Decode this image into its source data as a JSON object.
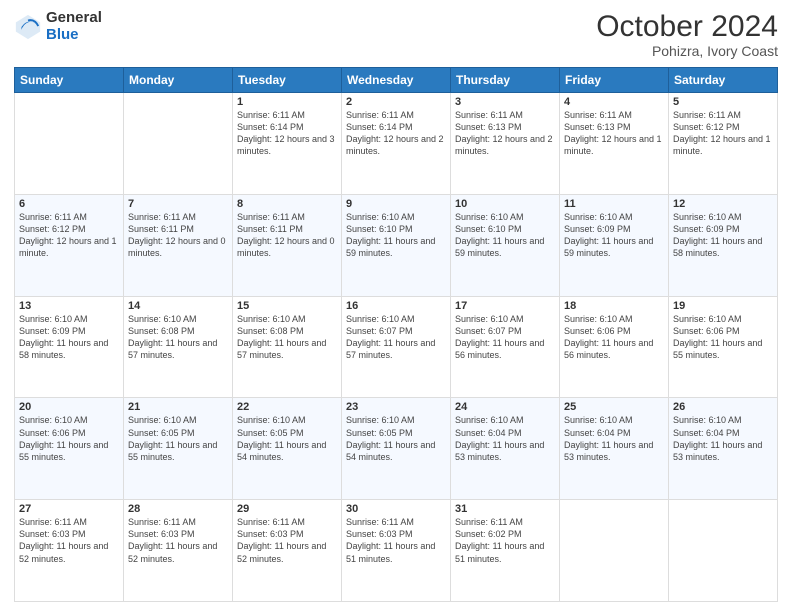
{
  "header": {
    "logo_general": "General",
    "logo_blue": "Blue",
    "title": "October 2024",
    "subtitle": "Pohizra, Ivory Coast"
  },
  "weekdays": [
    "Sunday",
    "Monday",
    "Tuesday",
    "Wednesday",
    "Thursday",
    "Friday",
    "Saturday"
  ],
  "weeks": [
    [
      {
        "day": "",
        "sunrise": "",
        "sunset": "",
        "daylight": ""
      },
      {
        "day": "",
        "sunrise": "",
        "sunset": "",
        "daylight": ""
      },
      {
        "day": "1",
        "sunrise": "Sunrise: 6:11 AM",
        "sunset": "Sunset: 6:14 PM",
        "daylight": "Daylight: 12 hours and 3 minutes."
      },
      {
        "day": "2",
        "sunrise": "Sunrise: 6:11 AM",
        "sunset": "Sunset: 6:14 PM",
        "daylight": "Daylight: 12 hours and 2 minutes."
      },
      {
        "day": "3",
        "sunrise": "Sunrise: 6:11 AM",
        "sunset": "Sunset: 6:13 PM",
        "daylight": "Daylight: 12 hours and 2 minutes."
      },
      {
        "day": "4",
        "sunrise": "Sunrise: 6:11 AM",
        "sunset": "Sunset: 6:13 PM",
        "daylight": "Daylight: 12 hours and 1 minute."
      },
      {
        "day": "5",
        "sunrise": "Sunrise: 6:11 AM",
        "sunset": "Sunset: 6:12 PM",
        "daylight": "Daylight: 12 hours and 1 minute."
      }
    ],
    [
      {
        "day": "6",
        "sunrise": "Sunrise: 6:11 AM",
        "sunset": "Sunset: 6:12 PM",
        "daylight": "Daylight: 12 hours and 1 minute."
      },
      {
        "day": "7",
        "sunrise": "Sunrise: 6:11 AM",
        "sunset": "Sunset: 6:11 PM",
        "daylight": "Daylight: 12 hours and 0 minutes."
      },
      {
        "day": "8",
        "sunrise": "Sunrise: 6:11 AM",
        "sunset": "Sunset: 6:11 PM",
        "daylight": "Daylight: 12 hours and 0 minutes."
      },
      {
        "day": "9",
        "sunrise": "Sunrise: 6:10 AM",
        "sunset": "Sunset: 6:10 PM",
        "daylight": "Daylight: 11 hours and 59 minutes."
      },
      {
        "day": "10",
        "sunrise": "Sunrise: 6:10 AM",
        "sunset": "Sunset: 6:10 PM",
        "daylight": "Daylight: 11 hours and 59 minutes."
      },
      {
        "day": "11",
        "sunrise": "Sunrise: 6:10 AM",
        "sunset": "Sunset: 6:09 PM",
        "daylight": "Daylight: 11 hours and 59 minutes."
      },
      {
        "day": "12",
        "sunrise": "Sunrise: 6:10 AM",
        "sunset": "Sunset: 6:09 PM",
        "daylight": "Daylight: 11 hours and 58 minutes."
      }
    ],
    [
      {
        "day": "13",
        "sunrise": "Sunrise: 6:10 AM",
        "sunset": "Sunset: 6:09 PM",
        "daylight": "Daylight: 11 hours and 58 minutes."
      },
      {
        "day": "14",
        "sunrise": "Sunrise: 6:10 AM",
        "sunset": "Sunset: 6:08 PM",
        "daylight": "Daylight: 11 hours and 57 minutes."
      },
      {
        "day": "15",
        "sunrise": "Sunrise: 6:10 AM",
        "sunset": "Sunset: 6:08 PM",
        "daylight": "Daylight: 11 hours and 57 minutes."
      },
      {
        "day": "16",
        "sunrise": "Sunrise: 6:10 AM",
        "sunset": "Sunset: 6:07 PM",
        "daylight": "Daylight: 11 hours and 57 minutes."
      },
      {
        "day": "17",
        "sunrise": "Sunrise: 6:10 AM",
        "sunset": "Sunset: 6:07 PM",
        "daylight": "Daylight: 11 hours and 56 minutes."
      },
      {
        "day": "18",
        "sunrise": "Sunrise: 6:10 AM",
        "sunset": "Sunset: 6:06 PM",
        "daylight": "Daylight: 11 hours and 56 minutes."
      },
      {
        "day": "19",
        "sunrise": "Sunrise: 6:10 AM",
        "sunset": "Sunset: 6:06 PM",
        "daylight": "Daylight: 11 hours and 55 minutes."
      }
    ],
    [
      {
        "day": "20",
        "sunrise": "Sunrise: 6:10 AM",
        "sunset": "Sunset: 6:06 PM",
        "daylight": "Daylight: 11 hours and 55 minutes."
      },
      {
        "day": "21",
        "sunrise": "Sunrise: 6:10 AM",
        "sunset": "Sunset: 6:05 PM",
        "daylight": "Daylight: 11 hours and 55 minutes."
      },
      {
        "day": "22",
        "sunrise": "Sunrise: 6:10 AM",
        "sunset": "Sunset: 6:05 PM",
        "daylight": "Daylight: 11 hours and 54 minutes."
      },
      {
        "day": "23",
        "sunrise": "Sunrise: 6:10 AM",
        "sunset": "Sunset: 6:05 PM",
        "daylight": "Daylight: 11 hours and 54 minutes."
      },
      {
        "day": "24",
        "sunrise": "Sunrise: 6:10 AM",
        "sunset": "Sunset: 6:04 PM",
        "daylight": "Daylight: 11 hours and 53 minutes."
      },
      {
        "day": "25",
        "sunrise": "Sunrise: 6:10 AM",
        "sunset": "Sunset: 6:04 PM",
        "daylight": "Daylight: 11 hours and 53 minutes."
      },
      {
        "day": "26",
        "sunrise": "Sunrise: 6:10 AM",
        "sunset": "Sunset: 6:04 PM",
        "daylight": "Daylight: 11 hours and 53 minutes."
      }
    ],
    [
      {
        "day": "27",
        "sunrise": "Sunrise: 6:11 AM",
        "sunset": "Sunset: 6:03 PM",
        "daylight": "Daylight: 11 hours and 52 minutes."
      },
      {
        "day": "28",
        "sunrise": "Sunrise: 6:11 AM",
        "sunset": "Sunset: 6:03 PM",
        "daylight": "Daylight: 11 hours and 52 minutes."
      },
      {
        "day": "29",
        "sunrise": "Sunrise: 6:11 AM",
        "sunset": "Sunset: 6:03 PM",
        "daylight": "Daylight: 11 hours and 52 minutes."
      },
      {
        "day": "30",
        "sunrise": "Sunrise: 6:11 AM",
        "sunset": "Sunset: 6:03 PM",
        "daylight": "Daylight: 11 hours and 51 minutes."
      },
      {
        "day": "31",
        "sunrise": "Sunrise: 6:11 AM",
        "sunset": "Sunset: 6:02 PM",
        "daylight": "Daylight: 11 hours and 51 minutes."
      },
      {
        "day": "",
        "sunrise": "",
        "sunset": "",
        "daylight": ""
      },
      {
        "day": "",
        "sunrise": "",
        "sunset": "",
        "daylight": ""
      }
    ]
  ]
}
